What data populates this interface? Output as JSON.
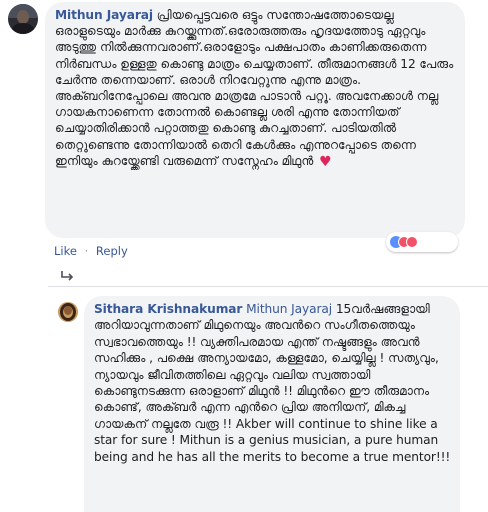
{
  "comment1": {
    "author": "Mithun Jayaraj",
    "text": "പ്രിയപ്പെട്ടവരെ ഒട്ടും സന്തോഷത്തോടെയല്ല ഒരാളുടെയും മാർക്കു കുറയ്ക്കുന്നത്.ഒരോരുത്തരും ഹൃദയത്തോടു ഏറ്റവും അടുത്തു നിൽക്കുന്നവരാണ്.ഒരാളോടും പക്ഷപാതം കാണിക്കരുതെന്ന നിർബന്ധം ഉള്ളതു കൊണ്ടു മാത്രം ചെയ്യതാണ്. തീരുമാനങ്ങൾ 12 പേരും ചേർന്നു തന്നെയാണ്. ഒരാൾ നിറവേറ്റുന്നു എന്നു മാത്രം. അക്ബറിനേപ്പോലെ അവനു മാത്രമേ പാടാൻ പറ്റൂ. അവനേക്കാൾ നല്ല ഗായകനാണെന്ന തോന്നൽ കൊണ്ടല്ല ശരി എന്നു തോന്നിയത് ചെയ്യാതിരിക്കാൻ പറ്റാത്തതു കൊണ്ടു കുറച്ചതാണ്. പാടിയതിൽ തെറ്റുണ്ടെന്നു തോന്നിയാൽ തെറി കേൾക്കും എന്നുറപ്പോടെ തന്നെ ഇനിയും കുറയ്ക്കേണ്ടി വരുമെന്ന് സസ്നേഹം മിഥുൻ",
    "emoji": "♥",
    "like_label": "Like",
    "separator": "·",
    "reply_label": "Reply"
  },
  "comment2": {
    "author": "Sithara Krishnakumar",
    "mention": "Mithun Jayaraj",
    "text": "15വർഷങ്ങളായി അറിയാവുന്നതാണ് മിഥുനെയും അവൻറെ സംഗീതത്തെയും സ്വഭാവത്തെയും !! വ്യക്തിപരമായ എന്ത് നഷ്ടങ്ങളും അവൻ സഹിക്കും , പക്ഷെ അന്യായമോ, കള്ളമോ, ചെയ്യില്ല ! സത്യവും, ന്യായവും ജീവിതത്തിലെ ഏറ്റവും വലിയ സ്വത്തായി കൊണ്ടുനടക്കുന്ന ഒരാളാണ് മിഥുൻ !! മിഥുൻറെ ഈ തീരുമാനം കൊണ്ട്, അക്ബർ എന്ന എൻറെ പ്രിയ അനിയന്, മികച്ച ഗായകന് നല്ലതേ വരൂ !! Akber will continue to shine like a star for sure ! Mithun is a genius musician, a pure human being and he has all the merits to become a true mentor!!!"
  },
  "colors": {
    "bubble": "#f2f3f5",
    "link": "#385898",
    "text": "#1c1e21",
    "heart": "#e0245e"
  }
}
